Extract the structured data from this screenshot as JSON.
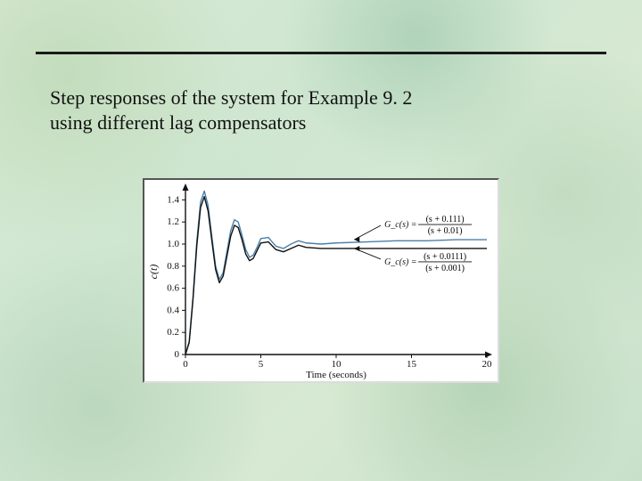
{
  "title_line1": "Step responses of the system for Example 9. 2",
  "title_line2": "using different lag compensators",
  "chart_data": {
    "type": "line",
    "title": "",
    "xlabel": "Time (seconds)",
    "ylabel": "c(t)",
    "xlim": [
      0,
      20
    ],
    "ylim": [
      0,
      1.5
    ],
    "xticks": [
      0,
      5,
      10,
      15,
      20
    ],
    "yticks": [
      0,
      0.2,
      0.4,
      0.6,
      0.8,
      1.0,
      1.2,
      1.4
    ],
    "annotations": [
      {
        "label_lhs": "G_c(s) =",
        "label_num": "(s + 0.111)",
        "label_den": "(s + 0.01)",
        "y_arrow": 1.04
      },
      {
        "label_lhs": "G_c(s) =",
        "label_num": "(s + 0.0111)",
        "label_den": "(s + 0.001)",
        "y_arrow": 0.96
      }
    ],
    "series": [
      {
        "name": "Gc = (s+0.111)/(s+0.01)",
        "color": "#4a80a8",
        "x": [
          0,
          0.25,
          0.5,
          0.75,
          1,
          1.25,
          1.5,
          1.75,
          2,
          2.25,
          2.5,
          2.75,
          3,
          3.25,
          3.5,
          3.75,
          4,
          4.25,
          4.5,
          4.75,
          5,
          5.5,
          6,
          6.5,
          7,
          7.5,
          8,
          9,
          10,
          12,
          14,
          16,
          18,
          20
        ],
        "y": [
          0,
          0.12,
          0.52,
          1.02,
          1.38,
          1.48,
          1.35,
          1.07,
          0.8,
          0.68,
          0.74,
          0.93,
          1.12,
          1.22,
          1.2,
          1.08,
          0.95,
          0.88,
          0.9,
          0.97,
          1.05,
          1.06,
          0.98,
          0.96,
          1.0,
          1.03,
          1.01,
          1.0,
          1.01,
          1.02,
          1.03,
          1.03,
          1.04,
          1.04
        ]
      },
      {
        "name": "Gc = (s+0.0111)/(s+0.001)",
        "color": "#111111",
        "x": [
          0,
          0.25,
          0.5,
          0.75,
          1,
          1.25,
          1.5,
          1.75,
          2,
          2.25,
          2.5,
          2.75,
          3,
          3.25,
          3.5,
          3.75,
          4,
          4.25,
          4.5,
          4.75,
          5,
          5.5,
          6,
          6.5,
          7,
          7.5,
          8,
          9,
          10,
          12,
          14,
          16,
          18,
          20
        ],
        "y": [
          0,
          0.11,
          0.5,
          0.98,
          1.33,
          1.43,
          1.3,
          1.03,
          0.77,
          0.65,
          0.71,
          0.89,
          1.07,
          1.17,
          1.15,
          1.04,
          0.91,
          0.85,
          0.87,
          0.94,
          1.01,
          1.02,
          0.95,
          0.93,
          0.96,
          0.99,
          0.97,
          0.96,
          0.96,
          0.96,
          0.96,
          0.96,
          0.96,
          0.96
        ]
      }
    ]
  }
}
